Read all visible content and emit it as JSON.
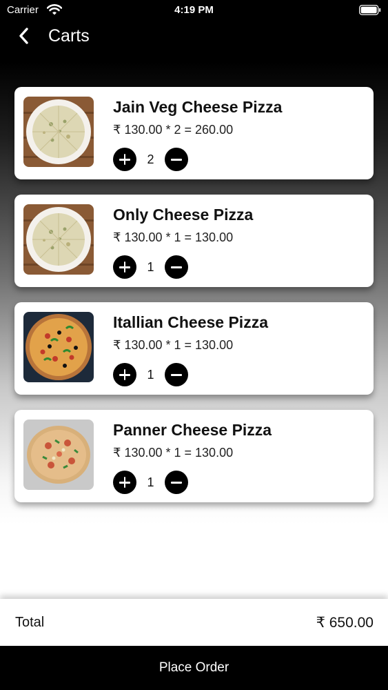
{
  "status_bar": {
    "carrier": "Carrier",
    "time": "4:19 PM"
  },
  "nav": {
    "title": "Carts"
  },
  "cart": {
    "items": [
      {
        "name": "Jain Veg Cheese Pizza",
        "price_line": "₹ 130.00 * 2 = 260.00",
        "quantity": "2"
      },
      {
        "name": "Only Cheese Pizza",
        "price_line": "₹ 130.00 * 1 = 130.00",
        "quantity": "1"
      },
      {
        "name": "Itallian Cheese Pizza",
        "price_line": "₹ 130.00 * 1 = 130.00",
        "quantity": "1"
      },
      {
        "name": "Panner Cheese Pizza",
        "price_line": "₹ 130.00 * 1 = 130.00",
        "quantity": "1"
      }
    ]
  },
  "summary": {
    "total_label": "Total",
    "total_value": "₹ 650.00"
  },
  "actions": {
    "place_order": "Place Order"
  },
  "colors": {
    "background_top": "#000000",
    "card": "#ffffff",
    "button": "#000000",
    "text": "#111111"
  },
  "icons": {
    "back": "chevron-left-icon",
    "plus": "plus-circle-icon",
    "minus": "minus-circle-icon",
    "wifi": "wifi-icon",
    "battery": "battery-icon"
  }
}
